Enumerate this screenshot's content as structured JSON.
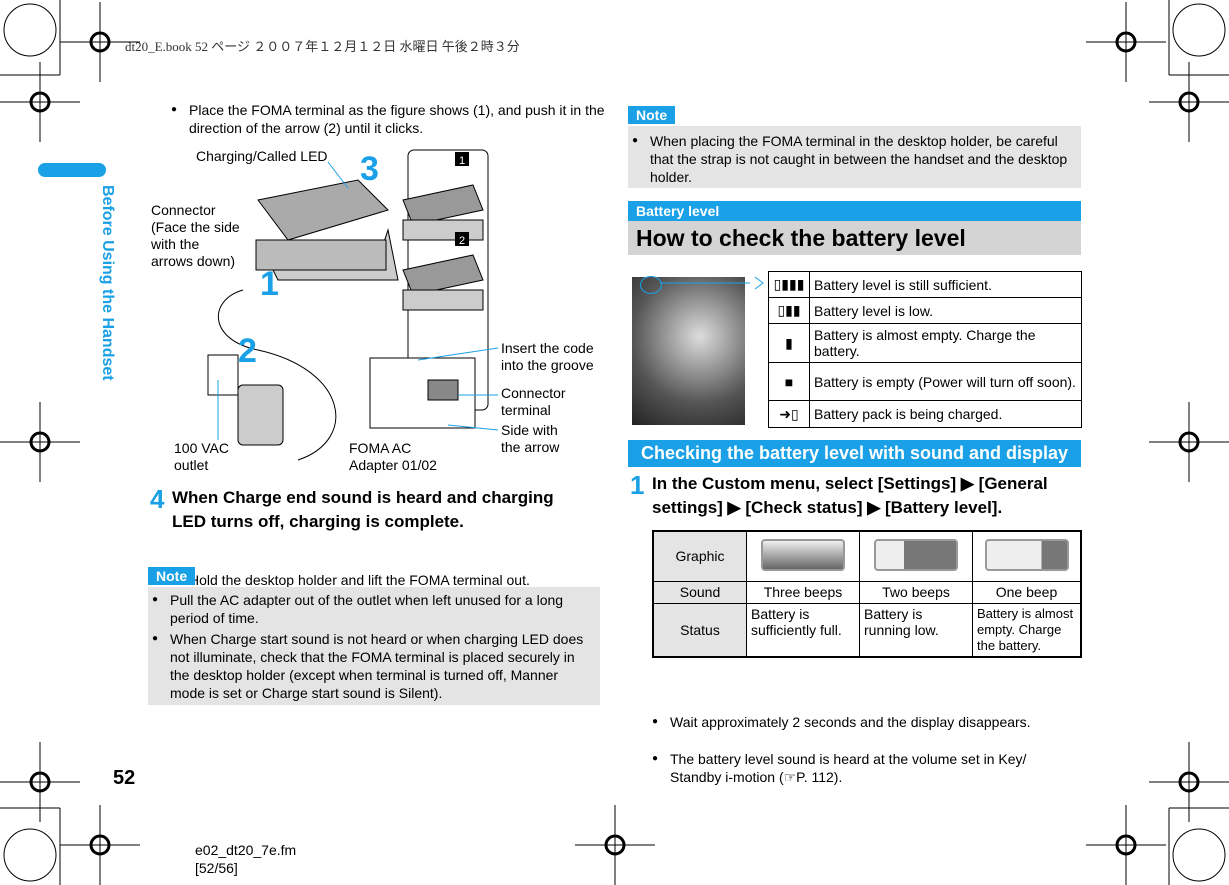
{
  "header": {
    "bookinfo": "dt20_E.book  52 ページ  ２００７年１２月１２日  水曜日  午後２時３分"
  },
  "side_tab": {
    "label": "Before Using the Handset",
    "color": "#1aa0e6"
  },
  "page_number": "52",
  "footer": {
    "file": "e02_dt20_7e.fm",
    "pages": "[52/56]"
  },
  "left": {
    "intro_bullet": "Place the FOMA terminal as the figure shows (1), and push it in the direction of the arrow (2) until it clicks.",
    "figure": {
      "labels": {
        "led": "Charging/Called LED",
        "connector": "Connector (Face the side with the arrows down)",
        "insert": "Insert the code into the groove",
        "terminal": "Connector terminal",
        "side": "Side with the arrow",
        "outlet": "100 VAC outlet",
        "adapter": "FOMA AC Adapter 01/02"
      },
      "step_marks": [
        "1",
        "2",
        "3"
      ],
      "box_marks": [
        "1",
        "2"
      ]
    },
    "step4": {
      "num": "4",
      "text": "When Charge end sound is heard and charging LED turns off, charging is complete.",
      "bullet": "Hold the desktop holder and lift the FOMA terminal out."
    },
    "note": {
      "label": "Note",
      "items": [
        "Pull the AC adapter out of the outlet when left unused for a long period of time.",
        "When Charge start sound is not heard or when charging LED does not illuminate, check that the FOMA terminal is placed securely in the desktop holder (except when terminal is turned off, Manner mode is set or Charge start sound is Silent)."
      ]
    }
  },
  "right": {
    "note": {
      "label": "Note",
      "items": [
        "When placing the FOMA terminal in the desktop holder, be careful that the strap is not caught in between the handset and the desktop holder."
      ]
    },
    "section_label": "Battery level",
    "section_title": "How to check the battery level",
    "icon_table": [
      {
        "icon": "battery-3-icon",
        "text": "Battery level is still sufficient."
      },
      {
        "icon": "battery-2-icon",
        "text": "Battery level is low."
      },
      {
        "icon": "battery-1-icon",
        "text": "Battery is almost empty. Charge the battery."
      },
      {
        "icon": "battery-empty-icon",
        "text": "Battery is empty (Power will turn off soon)."
      },
      {
        "icon": "charging-icon",
        "text": "Battery pack is being charged."
      }
    ],
    "sub_title": "Checking the battery level with sound and display",
    "step1": {
      "num": "1",
      "text": "In the Custom menu, select [Settings] ▶ [General settings] ▶ [Check status] ▶ [Battery level]."
    },
    "table": {
      "rows": [
        {
          "head": "Graphic",
          "cells": [
            3,
            2,
            1
          ]
        },
        {
          "head": "Sound",
          "cells": [
            "Three beeps",
            "Two beeps",
            "One beep"
          ]
        },
        {
          "head": "Status",
          "cells": [
            "Battery is sufficiently full.",
            "Battery is running low.",
            "Battery is almost empty. Charge the battery."
          ]
        }
      ]
    },
    "bullets": [
      "Wait approximately 2 seconds and the display disappears.",
      "The battery level sound is heard at the volume set in Key/ Standby i-motion (☞P. 112)."
    ]
  }
}
